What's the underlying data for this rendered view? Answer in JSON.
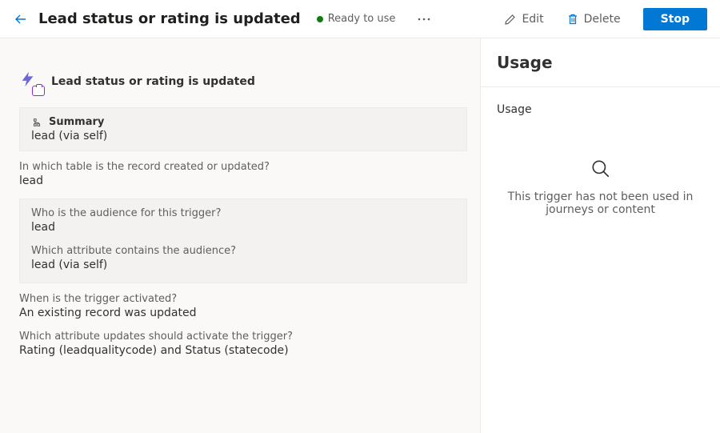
{
  "header": {
    "title": "Lead status or rating is updated",
    "status_label": "Ready to use",
    "edit_label": "Edit",
    "delete_label": "Delete",
    "stop_label": "Stop"
  },
  "main": {
    "card_title": "Lead status or rating is updated",
    "summary": {
      "heading": "Summary",
      "value": "lead (via self)"
    },
    "table_q": "In which table is the record created or updated?",
    "table_v": "lead",
    "audience_q": "Who is the audience for this trigger?",
    "audience_v": "lead",
    "attr_q": "Which attribute contains the audience?",
    "attr_v": "lead (via self)",
    "when_q": "When is the trigger activated?",
    "when_v": "An existing record was updated",
    "which_q": "Which attribute updates should activate the trigger?",
    "which_v": "Rating (leadqualitycode) and Status (statecode)"
  },
  "side": {
    "title": "Usage",
    "subtitle": "Usage",
    "empty_text": "This trigger has not been used in journeys or content"
  }
}
